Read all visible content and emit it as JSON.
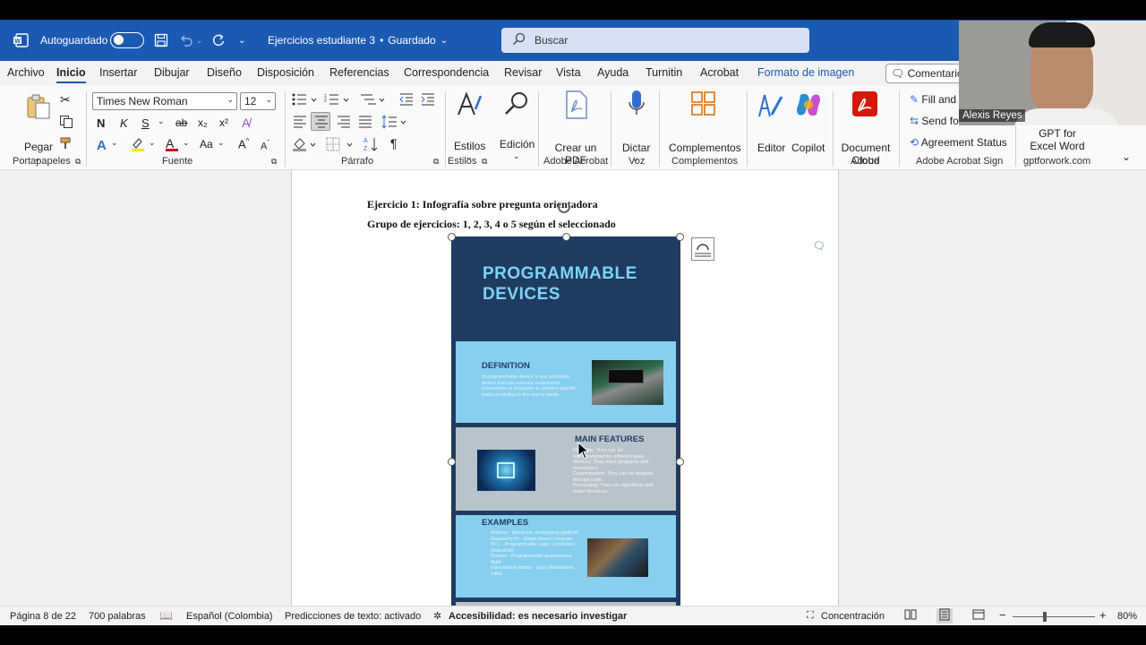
{
  "titlebar": {
    "autosave_label": "Autoguardado",
    "doc_title": "Ejercicios estudiante 3",
    "doc_status": "Guardado",
    "search_placeholder": "Buscar"
  },
  "menu": {
    "items": [
      "Archivo",
      "Inicio",
      "Insertar",
      "Dibujar",
      "Diseño",
      "Disposición",
      "Referencias",
      "Correspondencia",
      "Revisar",
      "Vista",
      "Ayuda",
      "Turnitin",
      "Acrobat",
      "Formato de imagen"
    ],
    "comments_label": "Comentario"
  },
  "ribbon": {
    "paste_label": "Pegar",
    "font_name": "Times New Roman",
    "font_size": "12",
    "bold": "N",
    "italic": "K",
    "underline": "S",
    "strike": "ab",
    "sub": "x₂",
    "sup": "x²",
    "font_color": "A",
    "case": "Aa",
    "grow": "A",
    "shrink": "A",
    "pilcrow": "¶",
    "styles_label": "Estilos",
    "edition_label": "Edición",
    "create_pdf_label": "Crear un PDF",
    "dictate_label": "Dictar",
    "addins_label": "Complementos",
    "editor_label": "Editor",
    "copilot_label": "Copilot",
    "doc_cloud_label": "Document Cloud",
    "fill_label": "Fill and",
    "send_label": "Send fo",
    "agreement_label": "Agreement Status",
    "gpt_label_1": "GPT for",
    "gpt_label_2": "Excel Word",
    "groups": {
      "clipboard": "Portapapeles",
      "font": "Fuente",
      "paragraph": "Párrafo",
      "styles": "Estilos",
      "adobe_acrobat": "Adobe Acrobat",
      "voice": "Voz",
      "addins": "Complementos",
      "adobe": "Adobe",
      "sign": "Adobe Acrobat Sign",
      "gpt": "gptforwork.com"
    }
  },
  "document": {
    "line1": "Ejercicio 1: Infografía sobre pregunta orientadora",
    "line2": "Grupo de ejercicios: 1, 2, 3, 4 o 5 según el seleccionado",
    "infographic": {
      "title_1": "PROGRAMMABLE",
      "title_2": "DEVICES",
      "definition_head": "DEFINITION",
      "definition_text": "A programmable device is any electronic device that can execute customized instructions or programs to perform specific tasks according to the user's needs.",
      "features_head": "MAIN FEATURES",
      "features": [
        "Flexibility: They can be reprogrammed for different tasks.",
        "Memory: They store programs and instructions.",
        "Customization: They can be adapted through code.",
        "Processing: They run algorithms and make decisions."
      ],
      "examples_head": "EXAMPLES",
      "examples": [
        "Arduino - Electronic prototyping platform",
        "Raspberry Pi - Single-board computer",
        "PLC - Programmable Logic Controllers (industrial)",
        "Drones - Programmable autonomous flight",
        "Educational robots - Lego Mindstorms, mBot"
      ]
    }
  },
  "status": {
    "page": "Página 8 de 22",
    "words": "700 palabras",
    "language": "Español (Colombia)",
    "predictions": "Predicciones de texto: activado",
    "accessibility": "Accesibilidad: es necesario investigar",
    "focus": "Concentración",
    "zoom": "80%"
  },
  "video": {
    "participant": "Alexis Reyes"
  },
  "colors": {
    "brand": "#1b5ab3",
    "infographic_bg": "#1f3b5f",
    "panel_blue": "#86cfee",
    "panel_gray": "#b9c3cc"
  }
}
